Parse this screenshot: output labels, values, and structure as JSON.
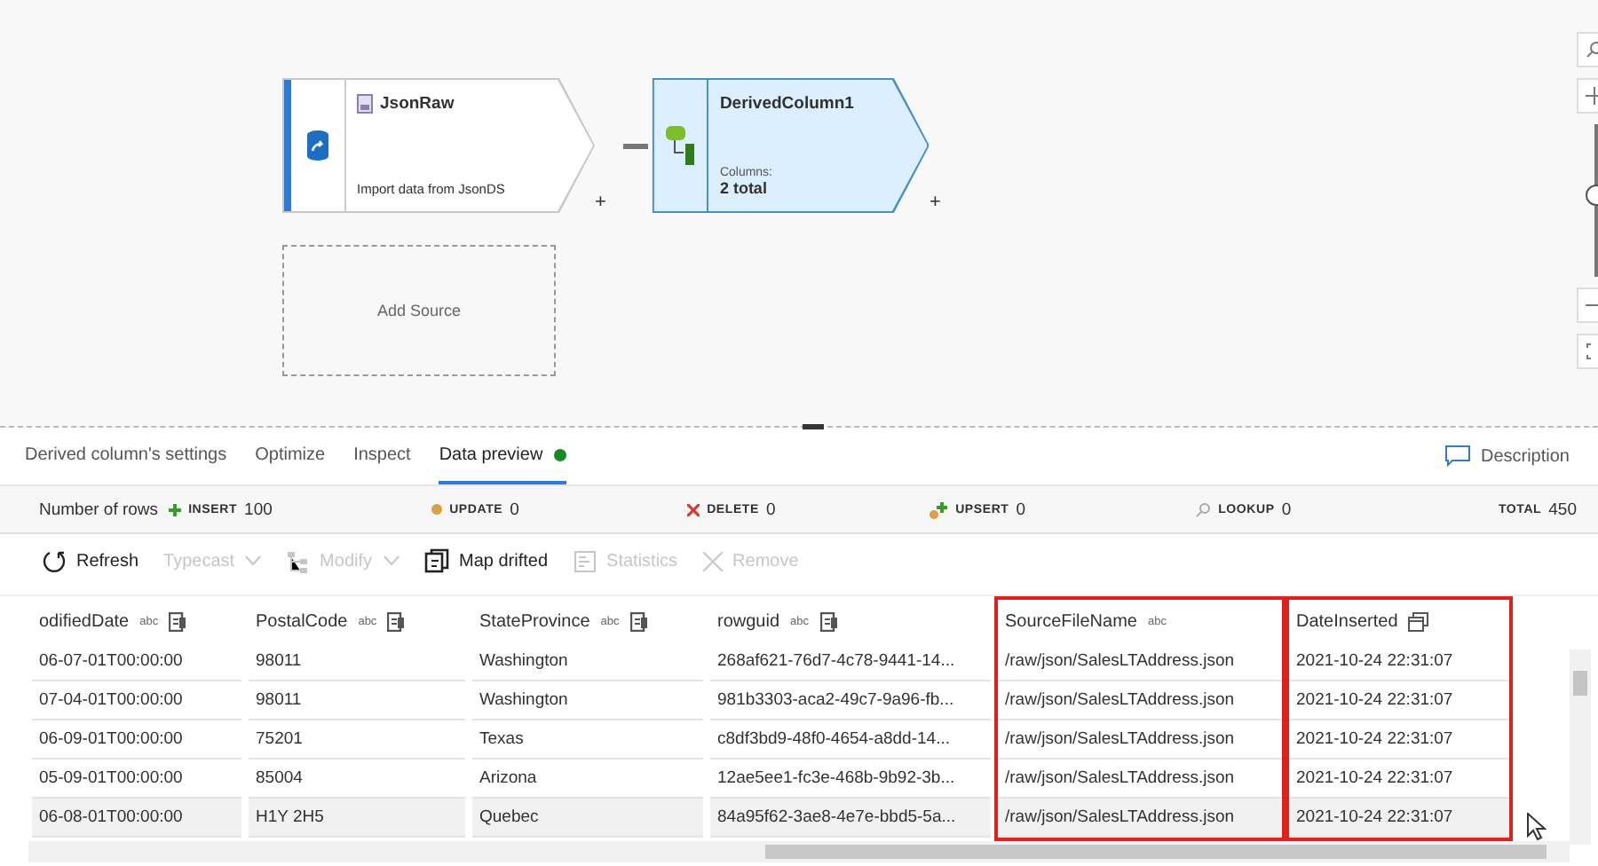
{
  "canvas": {
    "nodes": [
      {
        "kind": "source",
        "title": "JsonRaw",
        "subtitle": "Import data from JsonDS",
        "selected": false,
        "add_step": "+"
      },
      {
        "kind": "derived",
        "title": "DerivedColumn1",
        "caption": "Columns:",
        "summary": "2 total",
        "selected": true,
        "add_step": "+"
      }
    ],
    "zoom_slider": {
      "level": 0.55
    },
    "add_source": "Add Source"
  },
  "tabs": [
    {
      "label": "Derived column's settings",
      "selected": false
    },
    {
      "label": "Optimize",
      "selected": false
    },
    {
      "label": "Inspect",
      "selected": false
    },
    {
      "label": "Data preview",
      "selected": true,
      "status_dot": true
    }
  ],
  "description_button": "Description",
  "row_counts": {
    "label": "Number of rows",
    "items": [
      {
        "kind": "insert",
        "label": "INSERT",
        "value": "100"
      },
      {
        "kind": "update",
        "label": "UPDATE",
        "value": "0"
      },
      {
        "kind": "delete",
        "label": "DELETE",
        "value": "0"
      },
      {
        "kind": "upsert",
        "label": "UPSERT",
        "value": "0"
      },
      {
        "kind": "lookup",
        "label": "LOOKUP",
        "value": "0"
      },
      {
        "kind": "total",
        "label": "TOTAL",
        "value": "450"
      }
    ]
  },
  "toolbar": [
    {
      "kind": "refresh",
      "label": "Refresh",
      "disabled": false
    },
    {
      "kind": "typecast",
      "label": "Typecast",
      "disabled": true,
      "dropdown": true
    },
    {
      "kind": "modify",
      "label": "Modify",
      "disabled": true,
      "dropdown": true
    },
    {
      "kind": "map",
      "label": "Map drifted",
      "disabled": false
    },
    {
      "kind": "statistics",
      "label": "Statistics",
      "disabled": true
    },
    {
      "kind": "remove",
      "label": "Remove",
      "disabled": true
    }
  ],
  "table": {
    "columns": [
      {
        "name": "odifiedDate",
        "type_label": "abc",
        "copy_action": true,
        "highlighted": false
      },
      {
        "name": "PostalCode",
        "type_label": "abc",
        "copy_action": true,
        "highlighted": false
      },
      {
        "name": "StateProvince",
        "type_label": "abc",
        "copy_action": true,
        "highlighted": false
      },
      {
        "name": "rowguid",
        "type_label": "abc",
        "copy_action": true,
        "highlighted": false
      },
      {
        "name": "SourceFileName",
        "type_label": "abc",
        "copy_action": false,
        "highlighted": true
      },
      {
        "name": "DateInserted",
        "kind": "date",
        "copy_action": false,
        "highlighted": true
      }
    ],
    "rows": [
      {
        "hovered": false,
        "cells": [
          "06-07-01T00:00:00",
          "98011",
          "Washington",
          "268af621-76d7-4c78-9441-14...",
          "/raw/json/SalesLTAddress.json",
          "2021-10-24 22:31:07"
        ]
      },
      {
        "hovered": false,
        "cells": [
          "07-04-01T00:00:00",
          "98011",
          "Washington",
          "981b3303-aca2-49c7-9a96-fb...",
          "/raw/json/SalesLTAddress.json",
          "2021-10-24 22:31:07"
        ]
      },
      {
        "hovered": false,
        "cells": [
          "06-09-01T00:00:00",
          "75201",
          "Texas",
          "c8df3bd9-48f0-4654-a8dd-14...",
          "/raw/json/SalesLTAddress.json",
          "2021-10-24 22:31:07"
        ]
      },
      {
        "hovered": false,
        "cells": [
          "05-09-01T00:00:00",
          "85004",
          "Arizona",
          "12ae5ee1-fc3e-468b-9b92-3b...",
          "/raw/json/SalesLTAddress.json",
          "2021-10-24 22:31:07"
        ]
      },
      {
        "hovered": true,
        "cells": [
          "06-08-01T00:00:00",
          "H1Y 2H5",
          "Quebec",
          "84a95f62-3ae8-4e7e-bbd5-5a...",
          "/raw/json/SalesLTAddress.json",
          "2021-10-24 22:31:07"
        ]
      }
    ]
  }
}
